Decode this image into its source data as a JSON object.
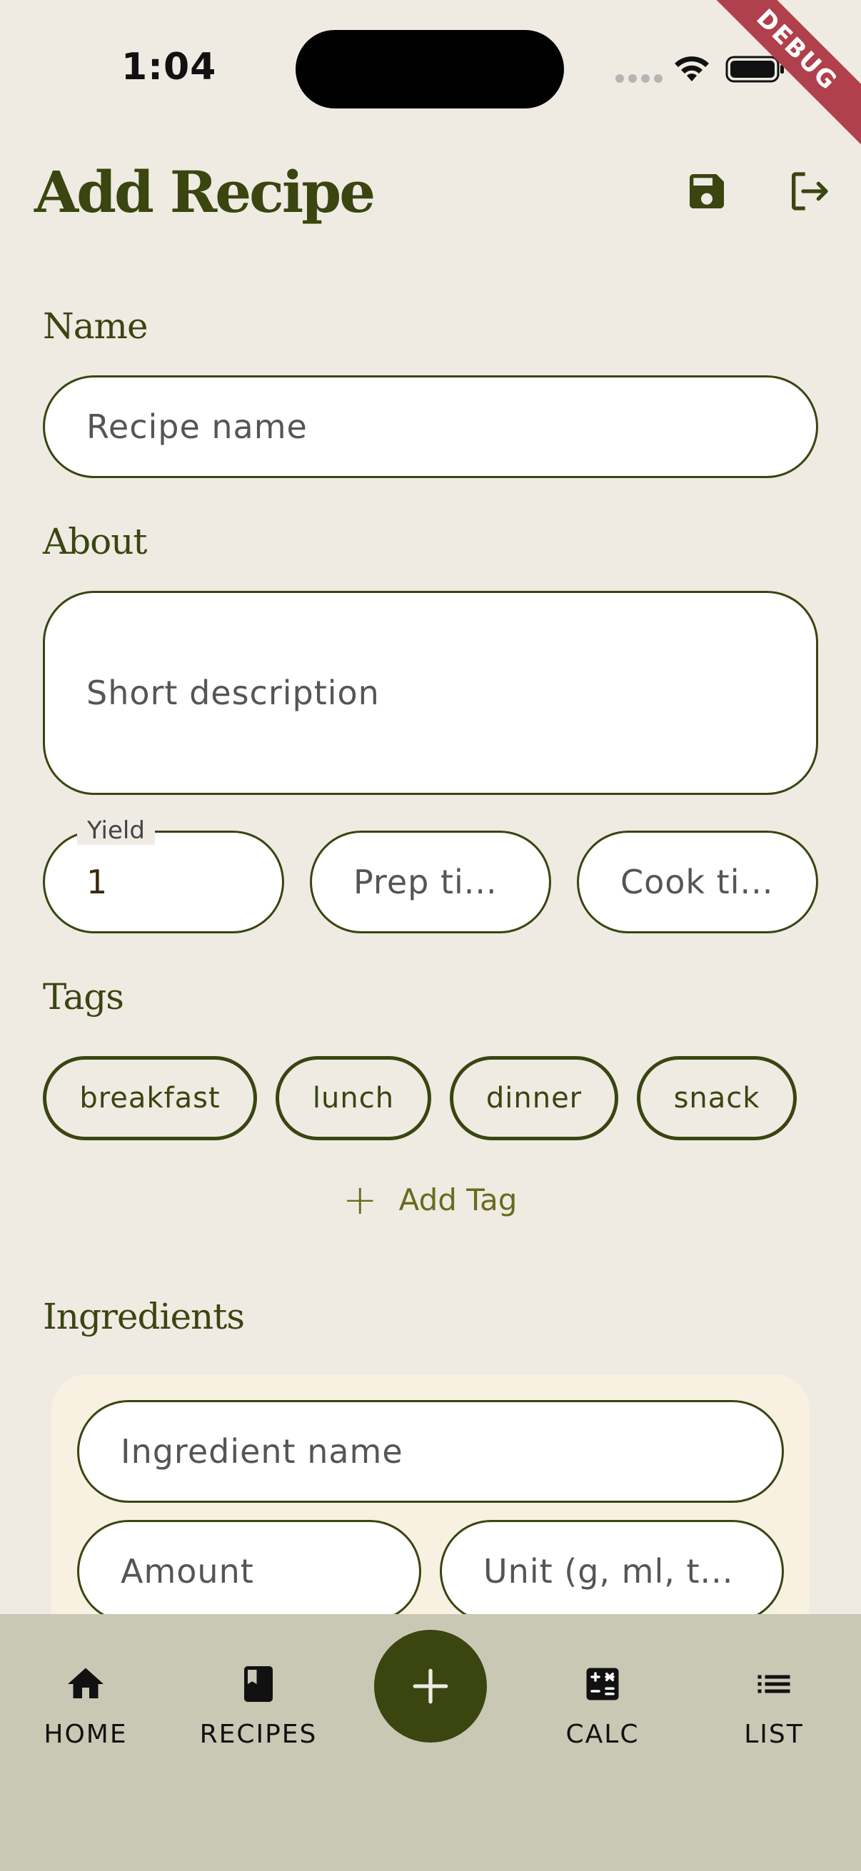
{
  "status_bar": {
    "time": "1:04",
    "debug_label": "DEBUG"
  },
  "header": {
    "title": "Add Recipe"
  },
  "name_section": {
    "label": "Name",
    "placeholder": "Recipe name"
  },
  "about_section": {
    "label": "About",
    "placeholder": "Short description"
  },
  "yield_field": {
    "label": "Yield",
    "value": "1"
  },
  "prep_time_field": {
    "placeholder": "Prep ti..."
  },
  "cook_time_field": {
    "placeholder": "Cook ti..."
  },
  "tags_section": {
    "label": "Tags",
    "tags": [
      "breakfast",
      "lunch",
      "dinner",
      "snack"
    ],
    "add_label": "Add Tag"
  },
  "ingredients_section": {
    "label": "Ingredients",
    "name_placeholder": "Ingredient name",
    "amount_placeholder": "Amount",
    "unit_placeholder": "Unit (g, ml, t..."
  },
  "bottom_nav": {
    "items": [
      {
        "label": "HOME",
        "icon": "home-icon"
      },
      {
        "label": "RECIPES",
        "icon": "book-icon"
      },
      {
        "label": "CALC",
        "icon": "calculator-icon"
      },
      {
        "label": "LIST",
        "icon": "list-icon"
      }
    ],
    "fab_icon": "plus-icon"
  },
  "colors": {
    "accent": "#3a4510",
    "background": "#efebe3",
    "nav_background": "#c9c8b5",
    "card_background": "#f8f1e2"
  }
}
